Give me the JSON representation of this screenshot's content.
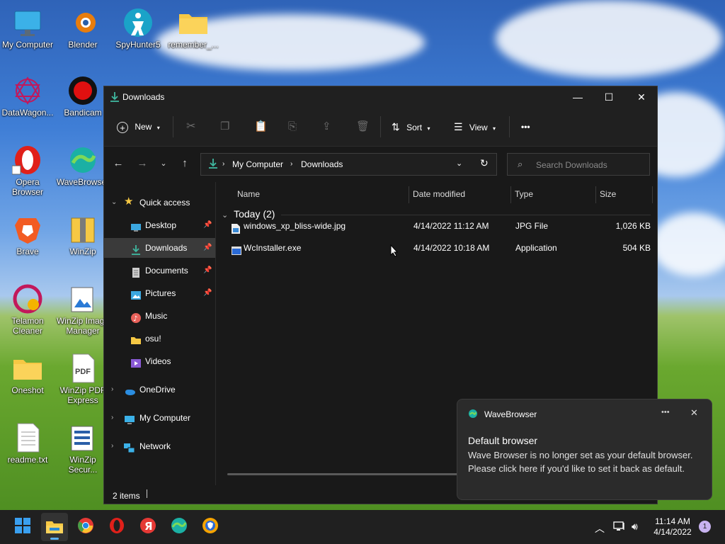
{
  "desktop": {
    "icons": [
      {
        "label": "My Computer",
        "icon": "computer-icon"
      },
      {
        "label": "Blender",
        "icon": "blender-icon"
      },
      {
        "label": "SpyHunter5",
        "icon": "spyhunter-icon"
      },
      {
        "label": "remember_...",
        "icon": "folder-icon"
      },
      {
        "label": "DataWagon...",
        "icon": "datawagon-icon"
      },
      {
        "label": "Bandicam",
        "icon": "bandicam-icon"
      },
      {
        "label": "Opera Browser",
        "icon": "opera-icon"
      },
      {
        "label": "WaveBrowser",
        "icon": "wavebrowser-icon"
      },
      {
        "label": "Brave",
        "icon": "brave-icon"
      },
      {
        "label": "WinZip",
        "icon": "winzip-icon"
      },
      {
        "label": "Telamon Cleaner",
        "icon": "telamon-icon"
      },
      {
        "label": "WinZip Image Manager",
        "icon": "winzip-image-icon"
      },
      {
        "label": "Oneshot",
        "icon": "folder-icon"
      },
      {
        "label": "WinZip PDF Express",
        "icon": "pdf-icon"
      },
      {
        "label": "readme.txt",
        "icon": "text-file-icon"
      },
      {
        "label": "WinZip Secur...",
        "icon": "winzip-secure-icon"
      }
    ]
  },
  "explorer": {
    "title": "Downloads",
    "toolbar": {
      "new": "New",
      "sort": "Sort",
      "view": "View",
      "more": "•••"
    },
    "address": {
      "part1": "My Computer",
      "part2": "Downloads"
    },
    "search_placeholder": "Search Downloads",
    "sidebar": {
      "quick_access": "Quick access",
      "items": [
        "Desktop",
        "Downloads",
        "Documents",
        "Pictures",
        "Music",
        "osu!",
        "Videos"
      ],
      "onedrive": "OneDrive",
      "mycomputer": "My Computer",
      "network": "Network"
    },
    "columns": {
      "name": "Name",
      "date": "Date modified",
      "type": "Type",
      "size": "Size"
    },
    "group": "Today (2)",
    "files": [
      {
        "name": "windows_xp_bliss-wide.jpg",
        "date": "4/14/2022 11:12 AM",
        "type": "JPG File",
        "size": "1,026 KB"
      },
      {
        "name": "WcInstaller.exe",
        "date": "4/14/2022 10:18 AM",
        "type": "Application",
        "size": "504 KB"
      }
    ],
    "status": "2 items"
  },
  "toast": {
    "app": "WaveBrowser",
    "more": "•••",
    "title": "Default browser",
    "body": "Wave Browser is no longer set as your default browser. Please click here if you'd like to set it back as default."
  },
  "taskbar": {
    "time": "11:14 AM",
    "date": "4/14/2022",
    "badge": "1"
  }
}
